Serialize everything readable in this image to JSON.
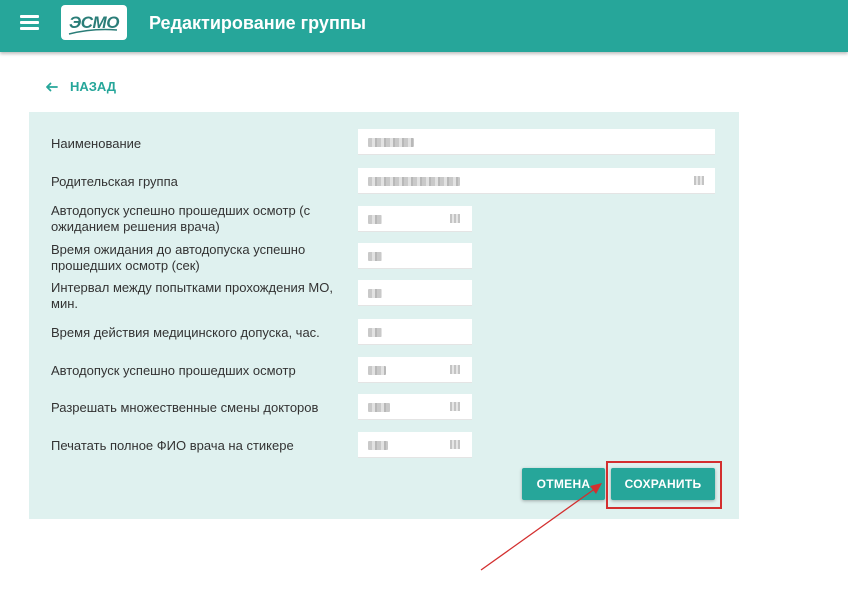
{
  "header": {
    "logo_text": "ЭСМО",
    "title": "Редактирование группы",
    "menu_icon": "hamburger-icon"
  },
  "nav": {
    "back_label": "НАЗАД",
    "back_icon": "arrow-left-icon"
  },
  "form": {
    "fields": [
      {
        "label": "Наименование",
        "type": "text"
      },
      {
        "label": "Родительская группа",
        "type": "select"
      },
      {
        "label": "Автодопуск успешно прошедших осмотр (с ожиданием решения врача)",
        "type": "select"
      },
      {
        "label": "Время ожидания до автодопуска успешно прошедших осмотр (сек)",
        "type": "number"
      },
      {
        "label": "Интервал между попытками прохождения МО, мин.",
        "type": "number"
      },
      {
        "label": "Время действия медицинского допуска, час.",
        "type": "number"
      },
      {
        "label": "Автодопуск успешно прошедших осмотр",
        "type": "select"
      },
      {
        "label": "Разрешать множественные смены докторов",
        "type": "select"
      },
      {
        "label": "Печатать полное ФИО врача на стикере",
        "type": "select"
      }
    ]
  },
  "actions": {
    "cancel_label": "ОТМЕНА",
    "save_label": "СОХРАНИТЬ"
  },
  "colors": {
    "brand": "#26a69a",
    "panel": "#dff1ef",
    "annotation": "#d32f2f"
  }
}
